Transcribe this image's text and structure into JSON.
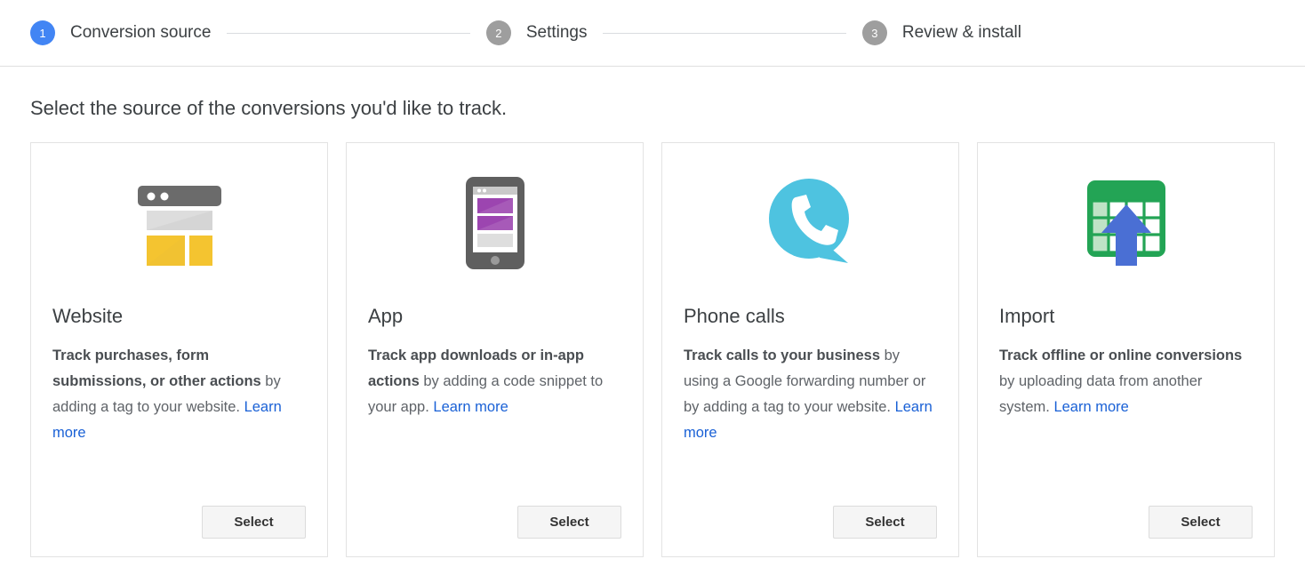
{
  "stepper": {
    "steps": [
      {
        "number": "1",
        "label": "Conversion source",
        "state": "active"
      },
      {
        "number": "2",
        "label": "Settings",
        "state": "inactive"
      },
      {
        "number": "3",
        "label": "Review & install",
        "state": "inactive"
      }
    ]
  },
  "main": {
    "heading": "Select the source of the conversions you'd like to track.",
    "cards": [
      {
        "icon": "website-icon",
        "title": "Website",
        "desc_bold": "Track purchases, form submissions, or other actions",
        "desc_rest": " by adding a tag to your website. ",
        "learn_more": "Learn more",
        "select_label": "Select"
      },
      {
        "icon": "mobile-app-icon",
        "title": "App",
        "desc_bold": "Track app downloads or in-app actions",
        "desc_rest": " by adding a code snippet to your app. ",
        "learn_more": "Learn more",
        "select_label": "Select"
      },
      {
        "icon": "phone-call-bubble-icon",
        "title": "Phone calls",
        "desc_bold": "Track calls to your business",
        "desc_rest": " by using a Google forwarding number or by adding a tag to your website. ",
        "learn_more": "Learn more",
        "select_label": "Select"
      },
      {
        "icon": "spreadsheet-upload-icon",
        "title": "Import",
        "desc_bold": "Track offline or online conversions",
        "desc_rest": " by uploading data from another system. ",
        "learn_more": "Learn more",
        "select_label": "Select"
      }
    ]
  },
  "colors": {
    "active_step": "#4285f4",
    "inactive_step": "#9e9e9e",
    "link": "#1a61d6",
    "website_yellow": "#f4c430",
    "app_purple": "#9c45b0",
    "phone_cyan": "#4ec3e0",
    "import_green": "#23a455",
    "import_arrow_blue": "#4a6fd4",
    "icon_gray": "#5f6368"
  }
}
